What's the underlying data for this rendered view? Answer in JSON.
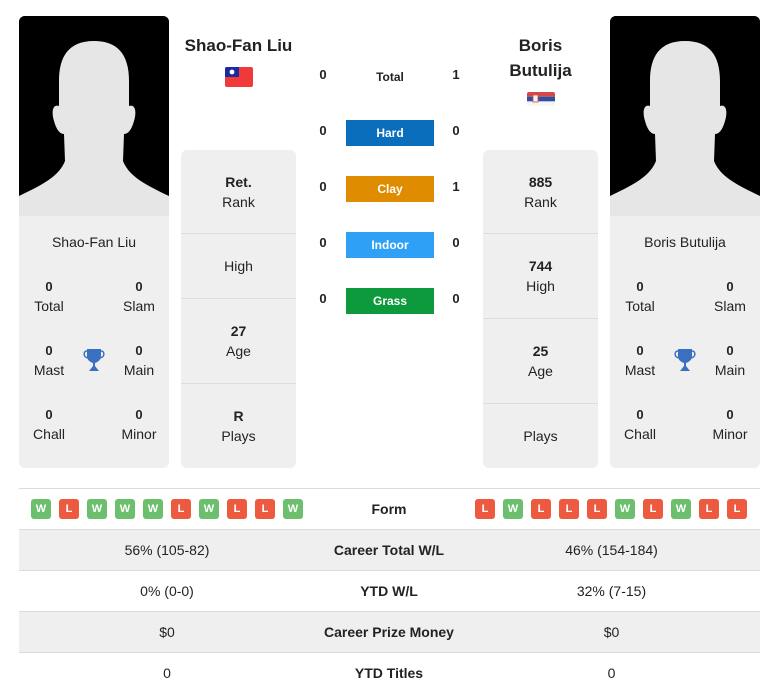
{
  "players": [
    {
      "name": "Shao-Fan Liu",
      "name_lines": [
        "Shao-Fan Liu"
      ],
      "flag": "taiwan-flag",
      "titles": {
        "total": {
          "value": "0",
          "label": "Total"
        },
        "slam": {
          "value": "0",
          "label": "Slam"
        },
        "mast": {
          "value": "0",
          "label": "Mast"
        },
        "main": {
          "value": "0",
          "label": "Main"
        },
        "chall": {
          "value": "0",
          "label": "Chall"
        },
        "minor": {
          "value": "0",
          "label": "Minor"
        }
      },
      "rank": {
        "value": "Ret.",
        "label": "Rank"
      },
      "high": {
        "value": "",
        "label": "High"
      },
      "age": {
        "value": "27",
        "label": "Age"
      },
      "plays": {
        "value": "R",
        "label": "Plays"
      },
      "form": [
        "W",
        "L",
        "W",
        "W",
        "W",
        "L",
        "W",
        "L",
        "L",
        "W"
      ],
      "career_wl": "56% (105-82)",
      "ytd_wl": "0% (0-0)",
      "prize": "$0",
      "ytd_titles": "0"
    },
    {
      "name": "Boris Butulija",
      "name_lines": [
        "Boris",
        "Butulija"
      ],
      "flag": "serbia-flag",
      "titles": {
        "total": {
          "value": "0",
          "label": "Total"
        },
        "slam": {
          "value": "0",
          "label": "Slam"
        },
        "mast": {
          "value": "0",
          "label": "Mast"
        },
        "main": {
          "value": "0",
          "label": "Main"
        },
        "chall": {
          "value": "0",
          "label": "Chall"
        },
        "minor": {
          "value": "0",
          "label": "Minor"
        }
      },
      "rank": {
        "value": "885",
        "label": "Rank"
      },
      "high": {
        "value": "744",
        "label": "High"
      },
      "age": {
        "value": "25",
        "label": "Age"
      },
      "plays": {
        "value": "",
        "label": "Plays"
      },
      "form": [
        "L",
        "W",
        "L",
        "L",
        "L",
        "W",
        "L",
        "W",
        "L",
        "L"
      ],
      "career_wl": "46% (154-184)",
      "ytd_wl": "32% (7-15)",
      "prize": "$0",
      "ytd_titles": "0"
    }
  ],
  "h2h": {
    "total": {
      "label": "Total",
      "p1": "0",
      "p2": "1"
    },
    "surfaces": [
      {
        "label": "Hard",
        "p1": "0",
        "p2": "0",
        "color": "#0a6ebd"
      },
      {
        "label": "Clay",
        "p1": "0",
        "p2": "1",
        "color": "#e08c00"
      },
      {
        "label": "Indoor",
        "p1": "0",
        "p2": "0",
        "color": "#2ea0f5"
      },
      {
        "label": "Grass",
        "p1": "0",
        "p2": "0",
        "color": "#0c9a3c"
      }
    ]
  },
  "table": {
    "form_label": "Form",
    "career_wl_label": "Career Total W/L",
    "ytd_wl_label": "YTD W/L",
    "prize_label": "Career Prize Money",
    "ytd_titles_label": "YTD Titles"
  },
  "colors": {
    "win": "#6cbf6c",
    "loss": "#ee5a3f",
    "trophy": "#3a70c0",
    "card_bg": "#efefef"
  }
}
